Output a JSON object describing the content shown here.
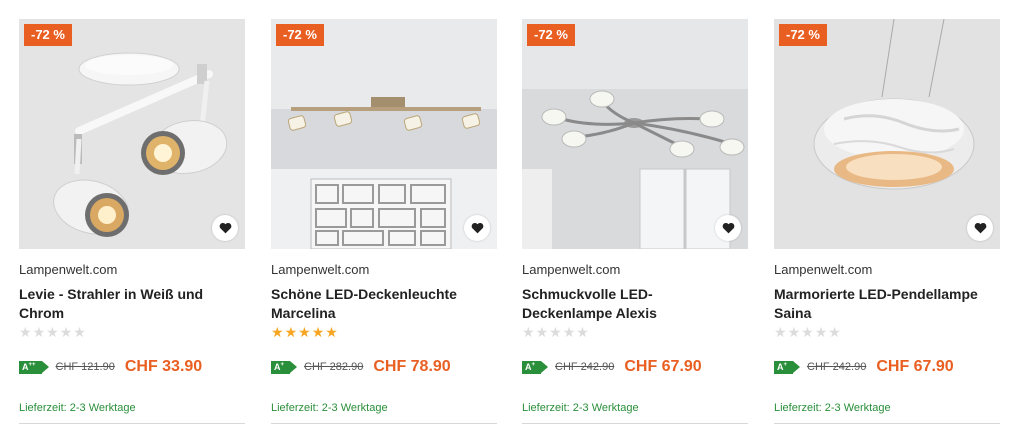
{
  "products": [
    {
      "discount": "-72 %",
      "shop": "Lampenwelt.com",
      "title": "Levie - Strahler in Weiß und Chrom",
      "rating_stars": 0,
      "energy": "A",
      "energy_sup": "++",
      "old_price": "CHF 121.90",
      "price": "CHF 33.90",
      "delivery": "Lieferzeit: 2-3 Werktage",
      "image_icon": "spotlight-lamp-image"
    },
    {
      "discount": "-72 %",
      "shop": "Lampenwelt.com",
      "title": "Schöne LED-Deckenleuchte Marcelina",
      "rating_stars": 5,
      "energy": "A",
      "energy_sup": "+",
      "old_price": "CHF 282.90",
      "price": "CHF 78.90",
      "delivery": "Lieferzeit: 2-3 Werktage",
      "image_icon": "ceiling-bar-lamp-image"
    },
    {
      "discount": "-72 %",
      "shop": "Lampenwelt.com",
      "title": "Schmuckvolle LED-Deckenlampe Alexis",
      "rating_stars": 0,
      "energy": "A",
      "energy_sup": "+",
      "old_price": "CHF 242.90",
      "price": "CHF 67.90",
      "delivery": "Lieferzeit: 2-3 Werktage",
      "image_icon": "multi-arm-ceiling-lamp-image"
    },
    {
      "discount": "-72 %",
      "shop": "Lampenwelt.com",
      "title": "Marmorierte LED-Pendellampe Saina",
      "rating_stars": 0,
      "energy": "A",
      "energy_sup": "+",
      "old_price": "CHF 242.90",
      "price": "CHF 67.90",
      "delivery": "Lieferzeit: 2-3 Werktage",
      "image_icon": "pendant-lamp-image"
    }
  ],
  "colors": {
    "discount_badge": "#e95f22",
    "price": "#e95f22",
    "energy_label": "#2a8f3a",
    "delivery_text": "#2a8f3a",
    "star_filled": "#f6a623",
    "star_empty": "#dcdcdc"
  }
}
